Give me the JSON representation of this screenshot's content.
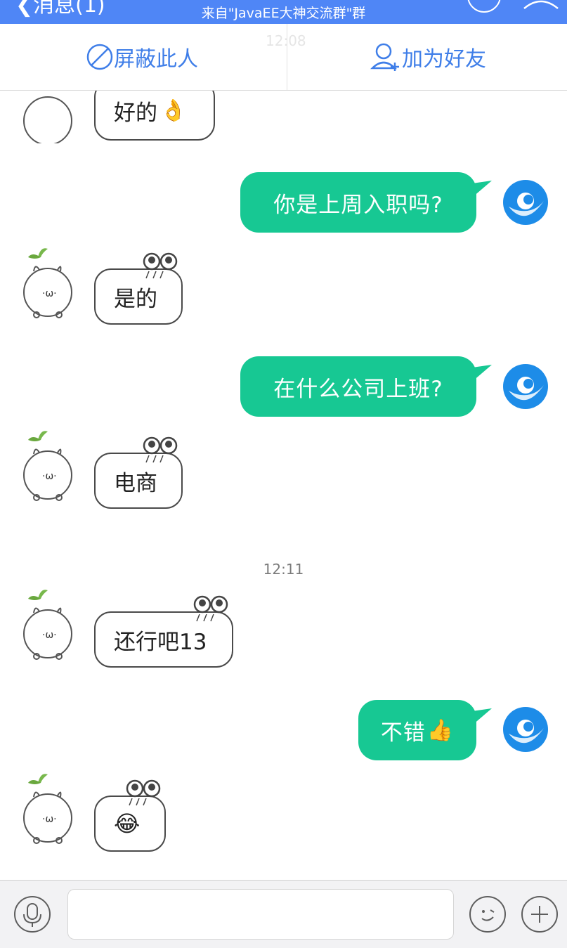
{
  "header": {
    "back_label": "❮消息(1)",
    "subtitle": "来自\"JavaEE大神交流群\"群"
  },
  "actions": {
    "block_label": "屏蔽此人",
    "add_friend_label": "加为好友"
  },
  "chat": {
    "ghost_time": "12:08",
    "msg1": "好的",
    "msg2": "你是上周入职吗?",
    "msg3": "是的",
    "msg4": "在什么公司上班?",
    "msg5": "电商",
    "time2": "12:11",
    "msg6": "还行吧13",
    "msg7": "不错"
  },
  "colors": {
    "header_bg": "#4f86f6",
    "outgoing_bubble": "#17c893",
    "action_text": "#3f7ee8"
  }
}
